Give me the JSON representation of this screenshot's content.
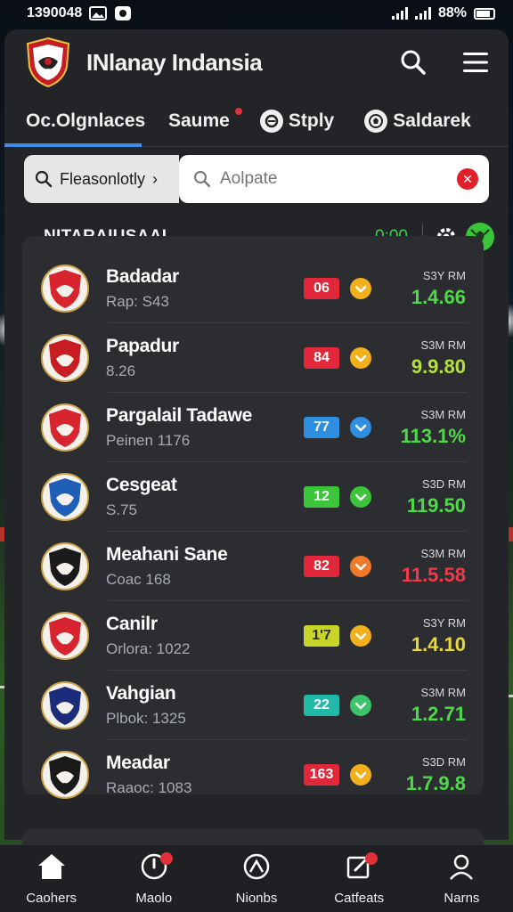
{
  "status_bar": {
    "time": "1390048",
    "battery": "88%"
  },
  "header": {
    "title": "INlanay Indansia"
  },
  "tabs": [
    {
      "label": "Oc.Olgnlaces",
      "active": true
    },
    {
      "label": "Saume",
      "dot": true
    },
    {
      "label": "Stply"
    },
    {
      "label": "Saldarek"
    }
  ],
  "search": {
    "filter_label": "Fleasonlotly",
    "filter_arrow": "›",
    "placeholder": "Aolpate"
  },
  "section": {
    "label": "NITARAIUSAAL",
    "time": "0:00"
  },
  "teams": [
    {
      "name": "Badadar",
      "sub": "Rap: S43",
      "tag": "06",
      "tag_color": "#e0283a",
      "tag_text": "#ffffff",
      "circle_color": "#f2b11c",
      "odds_label": "S3Y RM",
      "odds_value": "1.4.66",
      "odds_color": "#4fd94a",
      "badge_color": "#d8242e"
    },
    {
      "name": "Papadur",
      "sub": "8.26",
      "tag": "84",
      "tag_color": "#e0283a",
      "tag_text": "#ffffff",
      "circle_color": "#f2b11c",
      "odds_label": "S3M RM",
      "odds_value": "9.9.80",
      "odds_color": "#b6e03a",
      "badge_color": "#c81d22"
    },
    {
      "name": "Pargalail Tadawe",
      "sub": "Peinen 1176",
      "tag": "77",
      "tag_color": "#2e8fe0",
      "tag_text": "#ffffff",
      "circle_color": "#2e8fe0",
      "odds_label": "S3M RM",
      "odds_value": "113.1%",
      "odds_color": "#4fd94a",
      "badge_color": "#d8242e"
    },
    {
      "name": "Cesgeat",
      "sub": "S.75",
      "tag": "12",
      "tag_color": "#3cc43a",
      "tag_text": "#ffffff",
      "circle_color": "#3cc43a",
      "odds_label": "S3D RM",
      "odds_value": "119.50",
      "odds_color": "#4fd94a",
      "badge_color": "#1f5fb8"
    },
    {
      "name": "Meahani Sane",
      "sub": "Coac 168",
      "tag": "82",
      "tag_color": "#e0283a",
      "tag_text": "#ffffff",
      "circle_color": "#f07a2a",
      "odds_label": "S3M RM",
      "odds_value": "11.5.58",
      "odds_color": "#ee3a4a",
      "badge_color": "#1a1a1a"
    },
    {
      "name": "Canilr",
      "sub": "Orlora: 1022",
      "tag": "1'7",
      "tag_color": "#c8d42a",
      "tag_text": "#2a2a2a",
      "circle_color": "#f2b11c",
      "odds_label": "S3Y RM",
      "odds_value": "1.4.10",
      "odds_color": "#e8d83a",
      "badge_color": "#d8242e"
    },
    {
      "name": "Vahgian",
      "sub": "Plbok: 1325",
      "tag": "22",
      "tag_color": "#22b8a8",
      "tag_text": "#ffffff",
      "circle_color": "#3cc46a",
      "odds_label": "S3M RM",
      "odds_value": "1.2.71",
      "odds_color": "#4fd94a",
      "badge_color": "#1c2b7a"
    },
    {
      "name": "Meadar",
      "sub": "Raaoc: 1083",
      "tag": "163",
      "tag_color": "#e0283a",
      "tag_text": "#ffffff",
      "circle_color": "#f2b11c",
      "odds_label": "S3D RM",
      "odds_value": "1.7.9.8",
      "odds_color": "#4fd94a",
      "badge_color": "#1a1a1a"
    }
  ],
  "nav": [
    {
      "label": "Caohers",
      "icon": "home-icon"
    },
    {
      "label": "Maolo",
      "icon": "timer-icon",
      "badge": true
    },
    {
      "label": "Nionbs",
      "icon": "ball-icon"
    },
    {
      "label": "Catfeats",
      "icon": "edit-icon",
      "badge": true
    },
    {
      "label": "Narns",
      "icon": "user-icon"
    }
  ]
}
